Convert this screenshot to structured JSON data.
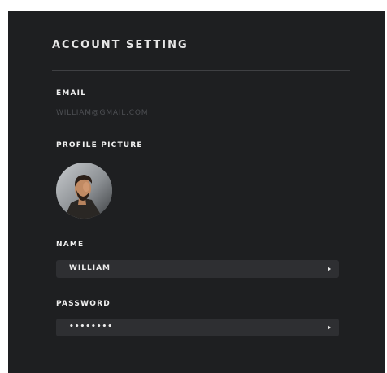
{
  "panel": {
    "title": "ACCOUNT SETTING"
  },
  "email": {
    "label": "EMAIL",
    "value": "WILLIAM@GMAIL.COM"
  },
  "profile_picture": {
    "label": "PROFILE PICTURE",
    "icon": "avatar-photo"
  },
  "name": {
    "label": "NAME",
    "value": "WILLIAM",
    "icon": "chevron-right-icon"
  },
  "password": {
    "label": "PASSWORD",
    "value": "••••••••",
    "icon": "chevron-right-icon"
  },
  "colors": {
    "background": "#1e1f21",
    "field_background": "#2e2f32",
    "text": "#f0f0f0",
    "muted_text": "#4d4f53"
  }
}
